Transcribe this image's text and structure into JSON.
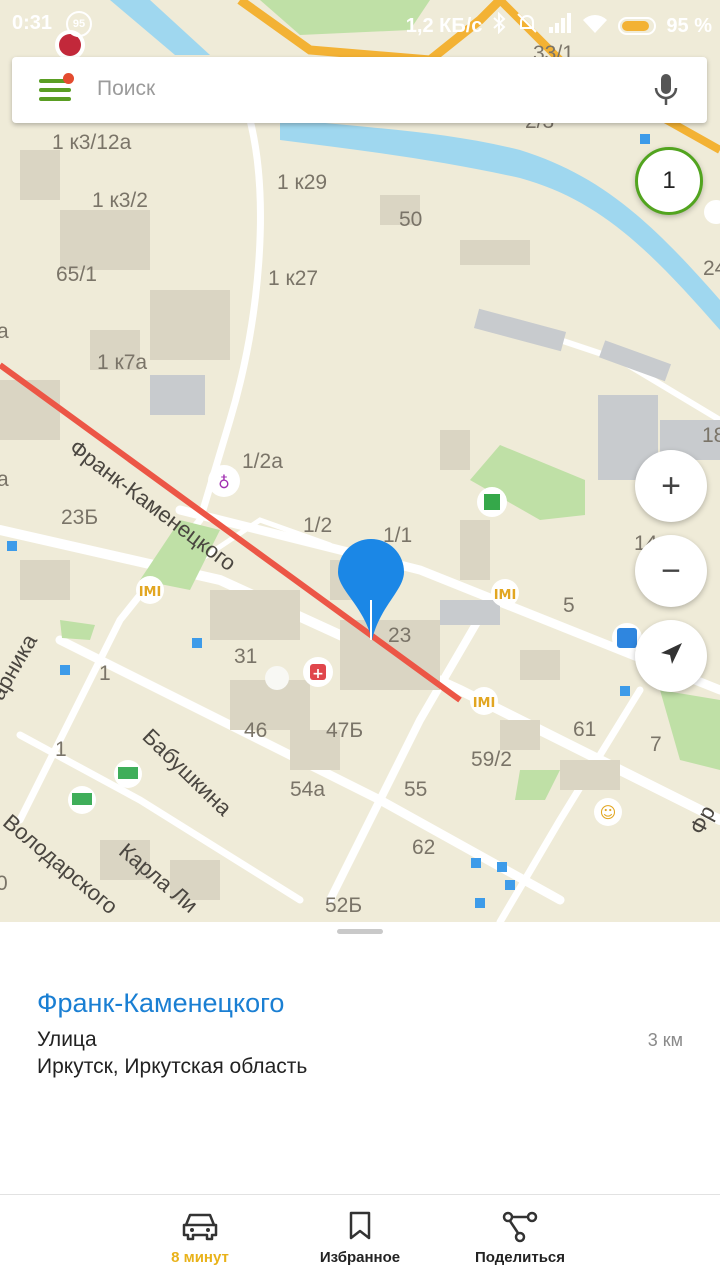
{
  "status_bar": {
    "time": "0:31",
    "notification_badge": "95",
    "network_speed": "1,2 КБ/с",
    "battery_percent": "95 %",
    "icons": [
      "bluetooth-icon",
      "mute-icon",
      "signal-icon",
      "wifi-icon",
      "battery-icon"
    ]
  },
  "search": {
    "placeholder": "Поиск"
  },
  "map": {
    "layer_badge": "1",
    "house_numbers": [
      "33/1",
      "2/3",
      "1 к3/12а",
      "1 к29",
      "1 к3/2",
      "50",
      "65/1",
      "1 к27",
      "24",
      "1 к7а",
      "1/2а",
      "18",
      "23Б",
      "1/2",
      "1/1",
      "14",
      "5",
      "31",
      "23",
      "1",
      "46",
      "47Б",
      "61",
      "7",
      "1",
      "59/2",
      "54а",
      "55",
      "62",
      "52Б",
      "0",
      "a",
      "a"
    ],
    "streets": [
      "Франк-Каменецкого",
      "Бабушкина",
      "Карла Ли",
      "Володарского",
      "арника",
      "Фр"
    ],
    "selected_street_color": "#ec5646",
    "marker_color": "#1b87e6"
  },
  "controls": {
    "zoom_in": "+",
    "zoom_out": "−"
  },
  "place": {
    "title": "Франк-Каменецкого",
    "type": "Улица",
    "distance": "3 км",
    "address": "Иркутск, Иркутская область"
  },
  "bottom_nav": {
    "items": [
      {
        "label": "8 минут",
        "icon": "car-icon",
        "color": "#e9b21a"
      },
      {
        "label": "Избранное",
        "icon": "bookmark-icon",
        "color": "#222222"
      },
      {
        "label": "Поделиться",
        "icon": "share-icon",
        "color": "#222222"
      }
    ]
  }
}
